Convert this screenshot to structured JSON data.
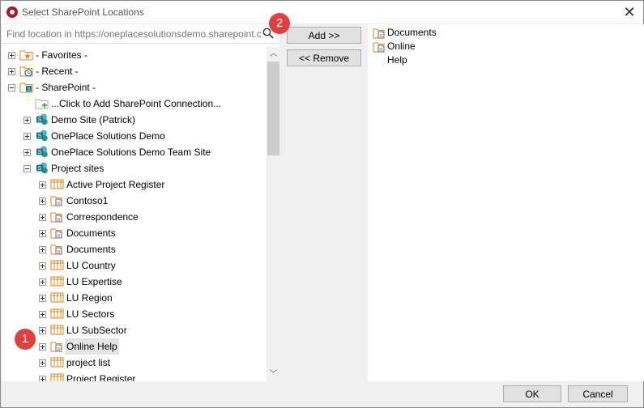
{
  "window": {
    "title": "Select SharePoint Locations",
    "close_glyph": "✕"
  },
  "search": {
    "placeholder": "Find location in https://oneplacesolutionsdemo.sharepoint.com/sites/",
    "icon": "search-icon"
  },
  "tree": {
    "items": [
      {
        "label": "- Favorites -",
        "icon": "favorites-star-icon",
        "expander": "plus"
      },
      {
        "label": "- Recent -",
        "icon": "recent-clock-icon",
        "expander": "plus"
      },
      {
        "label": "- SharePoint -",
        "icon": "sharepoint-folder-icon",
        "expander": "minus"
      },
      {
        "label": "...Click to Add SharePoint Connection...",
        "icon": "add-connection-icon",
        "expander": "none"
      },
      {
        "label": "Demo Site (Patrick)",
        "icon": "sharepoint-site-icon",
        "expander": "plus"
      },
      {
        "label": "OnePlace Solutions Demo",
        "icon": "sharepoint-site-icon",
        "expander": "plus"
      },
      {
        "label": "OnePlace Solutions Demo Team Site",
        "icon": "sharepoint-site-icon",
        "expander": "plus"
      },
      {
        "label": "Project sites",
        "icon": "sharepoint-site-icon",
        "expander": "minus"
      },
      {
        "label": "Active Project Register",
        "icon": "list-icon",
        "expander": "plus"
      },
      {
        "label": "Contoso1",
        "icon": "document-library-icon",
        "expander": "plus"
      },
      {
        "label": "Correspondence",
        "icon": "document-library-icon",
        "expander": "plus"
      },
      {
        "label": "Documents",
        "icon": "document-library-icon",
        "expander": "plus"
      },
      {
        "label": "Documents",
        "icon": "document-library-icon",
        "expander": "plus"
      },
      {
        "label": "LU Country",
        "icon": "list-icon",
        "expander": "plus"
      },
      {
        "label": "LU Expertise",
        "icon": "list-icon",
        "expander": "plus"
      },
      {
        "label": "LU Region",
        "icon": "list-icon",
        "expander": "plus"
      },
      {
        "label": "LU Sectors",
        "icon": "list-icon",
        "expander": "plus"
      },
      {
        "label": "LU SubSector",
        "icon": "list-icon",
        "expander": "plus"
      },
      {
        "label": "Online Help",
        "icon": "document-library-icon",
        "expander": "plus",
        "selected": true
      },
      {
        "label": "project list",
        "icon": "list-icon",
        "expander": "plus"
      },
      {
        "label": "Project Register",
        "icon": "list-icon",
        "expander": "plus"
      }
    ]
  },
  "buttons": {
    "add": "Add >>",
    "remove": "<< Remove",
    "ok": "OK",
    "cancel": "Cancel"
  },
  "selected_locations": [
    {
      "label": "Documents",
      "icon": "document-library-icon"
    },
    {
      "label": "Online Help",
      "icon": "document-library-icon"
    }
  ],
  "annotations": {
    "step1": "1",
    "step2": "2"
  },
  "scrollbar": {
    "up_glyph": "︿",
    "down_glyph": "﹀"
  },
  "colors": {
    "orange": "#d88a2a",
    "teal": "#0b7a8a",
    "badge": "#e04040",
    "selection": "#e5e5e5"
  }
}
